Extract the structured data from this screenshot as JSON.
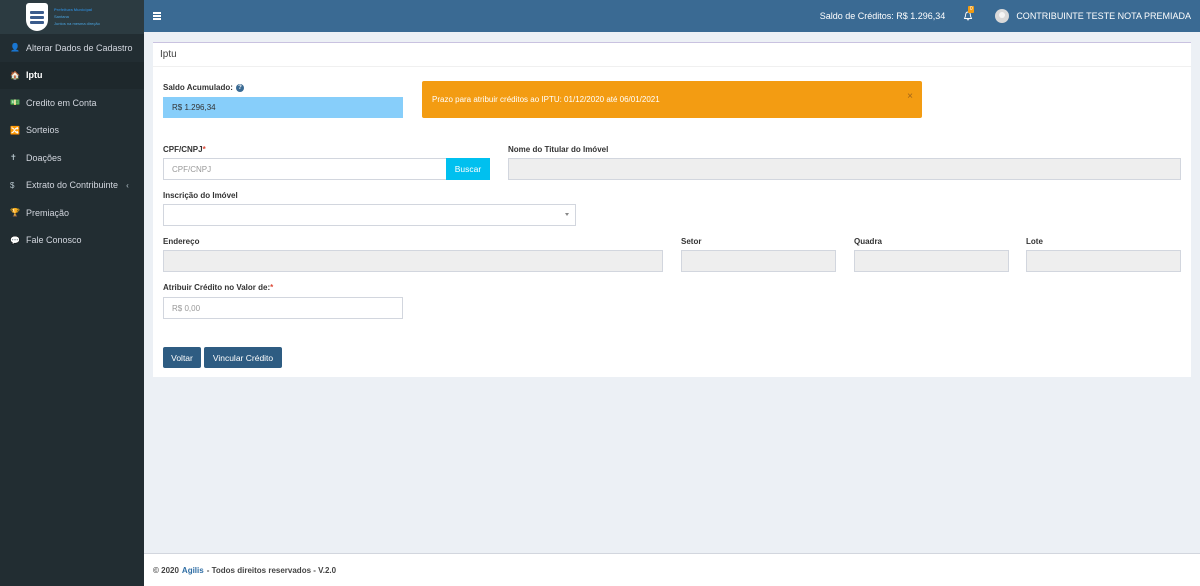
{
  "sidebar": {
    "logo": {
      "line1": "Prefeitura Municipal",
      "line2": "Santana",
      "line3": "Juntos na mesma direção"
    },
    "items": [
      {
        "label": "Alterar Dados de Cadastro",
        "icon": "user-icon",
        "glyph": "👤"
      },
      {
        "label": "Iptu",
        "icon": "home-icon",
        "glyph": "🏠"
      },
      {
        "label": "Credito em Conta",
        "icon": "money-icon",
        "glyph": "💵"
      },
      {
        "label": "Sorteios",
        "icon": "random-icon",
        "glyph": "🔀"
      },
      {
        "label": "Doações",
        "icon": "gift-icon",
        "glyph": "✝"
      },
      {
        "label": "Extrato do Contribuinte",
        "icon": "dollar-icon",
        "glyph": "$",
        "caret": "‹"
      },
      {
        "label": "Premiação",
        "icon": "trophy-icon",
        "glyph": "🏆"
      },
      {
        "label": "Fale Conosco",
        "icon": "comments-icon",
        "glyph": "💬"
      }
    ]
  },
  "topbar": {
    "credits": "Saldo de Créditos: R$ 1.296,34",
    "notification_count": "0",
    "user_name": "CONTRIBUINTE TESTE NOTA PREMIADA"
  },
  "page": {
    "title": "Iptu",
    "saldo_label": "Saldo Acumulado:",
    "help_glyph": "?",
    "saldo_value": "R$ 1.296,34",
    "alert_text": "Prazo para atribuir créditos ao IPTU: 01/12/2020 até 06/01/2021",
    "alert_close": "×",
    "cpf_label": "CPF/CNPJ",
    "required_mark": "*",
    "cpf_placeholder": "CPF/CNPJ",
    "buscar": "Buscar",
    "titular_label": "Nome do Titular do Imóvel",
    "inscricao_label": "Inscrição do Imóvel",
    "endereco_label": "Endereço",
    "setor_label": "Setor",
    "quadra_label": "Quadra",
    "lote_label": "Lote",
    "valor_label": "Atribuir Crédito no Valor de:",
    "valor_placeholder": "R$ 0,00",
    "btn_voltar": "Voltar",
    "btn_vincular": "Vincular Crédito"
  },
  "footer": {
    "prefix": "© 2020",
    "brand": "Agilis",
    "suffix": "- Todos direitos reservados - V.2.0"
  },
  "colors": {
    "sidebar_bg": "#222d32",
    "topbar_bg": "#3a6a93",
    "alert_bg": "#f39c12",
    "saldo_bg": "#87cefa",
    "buscar_bg": "#00c0ef",
    "button_bg": "#2e5c82"
  }
}
